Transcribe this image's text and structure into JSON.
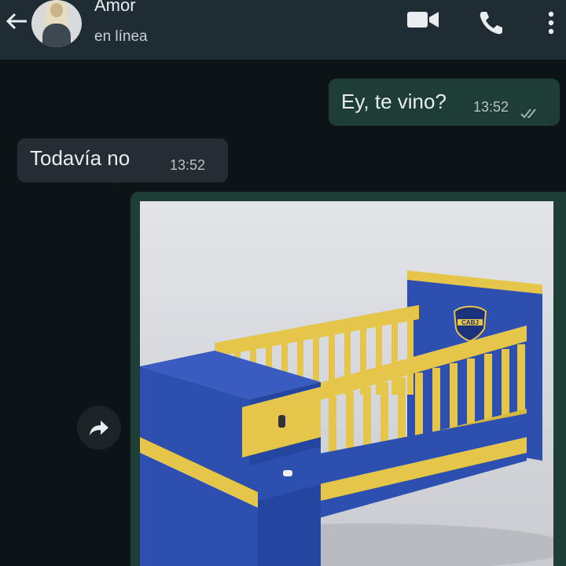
{
  "header": {
    "contact_name": "Amor",
    "status": "en línea",
    "icons": [
      "back-arrow-icon",
      "video-call-icon",
      "phone-icon",
      "more-vert-icon"
    ]
  },
  "messages": [
    {
      "direction": "out",
      "text": "Ey, te vino?",
      "time": "13:52",
      "status": "read"
    },
    {
      "direction": "in",
      "text": "Todavía no",
      "time": "13:52"
    }
  ],
  "image_message": {
    "direction": "out",
    "logo_text": "CABJ"
  },
  "colors": {
    "header_bg": "#1f2c33",
    "outgoing_bubble": "#1e3d34",
    "incoming_bubble": "#232d33",
    "crib_blue": "#2c4fb0",
    "crib_yellow": "#e6c64a"
  }
}
